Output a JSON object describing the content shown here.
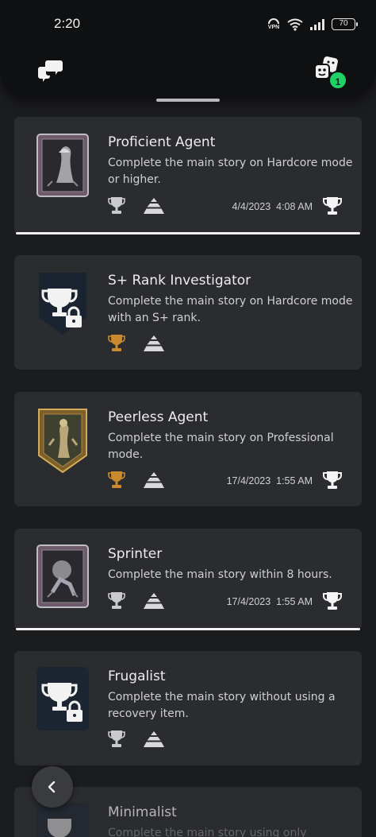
{
  "status": {
    "time": "2:20",
    "battery": "70",
    "vpn_label": "VPN"
  },
  "header": {
    "notification_badge": "1"
  },
  "trophies": [
    {
      "title": "Proficient Agent",
      "desc": "Complete the main story on Hardcore mode or higher.",
      "grade": "silver",
      "date": "4/4/2023",
      "time": "4:08 AM",
      "earned": true
    },
    {
      "title": "S+ Rank Investigator",
      "desc": "Complete the main story on Hardcore mode with an S+ rank.",
      "grade": "bronze",
      "earned": false
    },
    {
      "title": "Peerless Agent",
      "desc": "Complete the main story on Professional mode.",
      "grade": "bronze",
      "date": "17/4/2023",
      "time": "1:55 AM",
      "earned": true
    },
    {
      "title": "Sprinter",
      "desc": "Complete the main story within 8 hours.",
      "grade": "silver",
      "date": "17/4/2023",
      "time": "1:55 AM",
      "earned": true
    },
    {
      "title": "Frugalist",
      "desc": "Complete the main story without using a recovery item.",
      "grade": "silver",
      "earned": false
    },
    {
      "title": "Minimalist",
      "desc": "Complete the main story using only",
      "grade": "silver",
      "earned": false
    }
  ],
  "colors": {
    "silver": "#c9cacc",
    "bronze": "#c98a2e",
    "badge": "#1fd166",
    "card": "#2b2c2f"
  }
}
